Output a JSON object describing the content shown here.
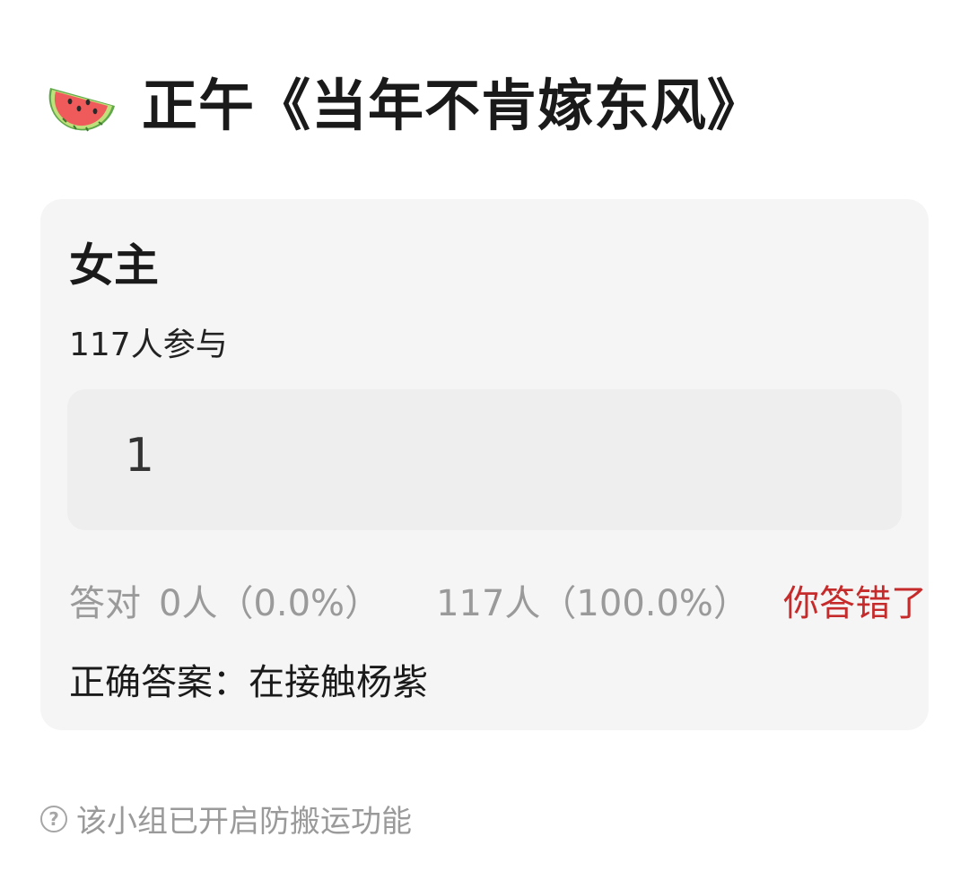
{
  "header": {
    "icon": "watermelon-icon",
    "title": "正午《当年不肯嫁东风》"
  },
  "quiz": {
    "title": "女主",
    "participants": "117人参与",
    "option": "1",
    "stats": {
      "correct_label": "答对",
      "correct_value": "0人（0.0%）",
      "wrong_value": "117人（100.0%）",
      "result": "你答错了"
    },
    "answer": "正确答案：在接触杨紫"
  },
  "footer": {
    "icon": "help-circle-icon",
    "help_symbol": "?",
    "notice": "该小组已开启防搬运功能"
  },
  "colors": {
    "card_background": "#f5f5f5",
    "option_background": "#eeeeee",
    "wrong_answer": "#c62b2b",
    "muted_text": "#9a9a9a"
  }
}
